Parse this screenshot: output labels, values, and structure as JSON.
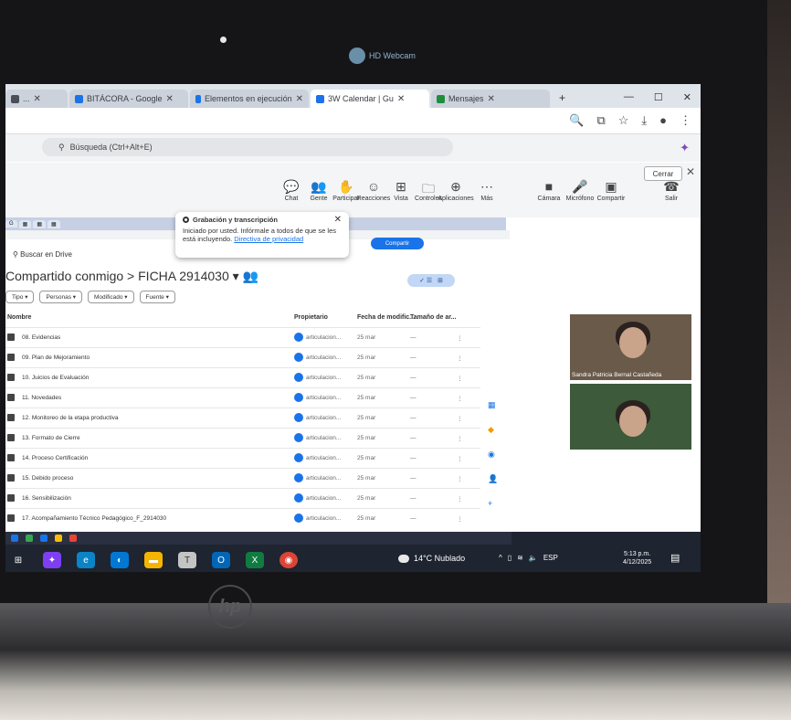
{
  "webcam": {
    "label": "HD Webcam"
  },
  "browser": {
    "tabs": [
      {
        "label": "...",
        "active": false,
        "color": "#4a4f57"
      },
      {
        "label": "BITÁCORA - Google",
        "active": false,
        "color": "#1a73e8"
      },
      {
        "label": "Elementos en ejecución",
        "active": false,
        "color": "#1a73e8"
      },
      {
        "label": "3W Calendar | Gu",
        "active": true,
        "color": "#1a73e8"
      },
      {
        "label": "Mensajes",
        "active": false,
        "color": "#1e8e3e"
      }
    ],
    "search_placeholder": "Búsqueda (Ctrl+Alt+E)"
  },
  "meet": {
    "cerrar_label": "Cerrar",
    "controls": [
      {
        "icon": "chat-icon",
        "glyph": "💬",
        "label": "Chat"
      },
      {
        "icon": "people-icon",
        "glyph": "👥",
        "label": "Gente"
      },
      {
        "icon": "raise-hand-icon",
        "glyph": "✋",
        "label": "Participar"
      },
      {
        "icon": "reactions-icon",
        "glyph": "☺",
        "label": "Reacciones"
      },
      {
        "icon": "view-icon",
        "glyph": "⊞",
        "label": "Vista"
      },
      {
        "icon": "notes-icon",
        "glyph": "🗀",
        "label": "Controles"
      },
      {
        "icon": "apps-icon",
        "glyph": "⊕",
        "label": "Aplicaciones"
      },
      {
        "icon": "more-icon",
        "glyph": "⋯",
        "label": "Más"
      },
      {
        "icon": "camera-icon",
        "glyph": "■",
        "label": "Cámara"
      },
      {
        "icon": "mic-icon",
        "glyph": "🎤",
        "label": "Micrófono"
      },
      {
        "icon": "share-icon",
        "glyph": "▣",
        "label": "Compartir"
      },
      {
        "icon": "leave-icon",
        "glyph": "☎",
        "label": "Salir"
      }
    ],
    "participants": [
      {
        "name": "Sandra Patricia Bernal Castañeda"
      },
      {
        "name": ""
      }
    ]
  },
  "popup": {
    "title": "Grabación y transcripción",
    "body": "Iniciado por usted. Infórmale a todos de que se les está incluyendo.",
    "link": "Directiva de privacidad"
  },
  "drive": {
    "search_label": "Buscar en Drive",
    "share_button": "Compartir",
    "breadcrumb": "Compartido conmigo  >  FICHA 2914030  ▾  👥",
    "filters": [
      "Tipo ▾",
      "Personas ▾",
      "Modificado ▾",
      "Fuente ▾"
    ],
    "columns": {
      "name": "Nombre",
      "owner": "Propietario",
      "date": "Fecha de modific...",
      "size": "Tamaño de ar..."
    },
    "rows": [
      {
        "name": "08. Evidencias",
        "owner": "articulacion...",
        "date": "25 mar",
        "size": "—",
        "menu": "⋮"
      },
      {
        "name": "09. Plan de Mejoramiento",
        "owner": "articulacion...",
        "date": "25 mar",
        "size": "—",
        "menu": "⋮"
      },
      {
        "name": "10. Juicios de Evaluación",
        "owner": "articulacion...",
        "date": "25 mar",
        "size": "—",
        "menu": "⋮"
      },
      {
        "name": "11. Novedades",
        "owner": "articulacion...",
        "date": "25 mar",
        "size": "—",
        "menu": "⋮"
      },
      {
        "name": "12. Monitoreo de la etapa productiva",
        "owner": "articulacion...",
        "date": "25 mar",
        "size": "—",
        "menu": "⋮"
      },
      {
        "name": "13. Formato de Cierre",
        "owner": "articulacion...",
        "date": "25 mar",
        "size": "—",
        "menu": "⋮"
      },
      {
        "name": "14. Proceso Certificación",
        "owner": "articulacion...",
        "date": "25 mar",
        "size": "—",
        "menu": "⋮"
      },
      {
        "name": "15. Debido proceso",
        "owner": "articulacion...",
        "date": "25 mar",
        "size": "—",
        "menu": "⋮"
      },
      {
        "name": "16. Sensibilización",
        "owner": "articulacion...",
        "date": "25 mar",
        "size": "—",
        "menu": "⋮"
      },
      {
        "name": "17. Acompañamiento Técnico Pedagógico_F_2914030",
        "owner": "articulacion...",
        "date": "25 mar",
        "size": "—",
        "menu": "⋮"
      }
    ]
  },
  "taskbar": {
    "weather": "14°C Nublado",
    "clock_time": "5:13 p.m.",
    "clock_date": "4/12/2025"
  }
}
